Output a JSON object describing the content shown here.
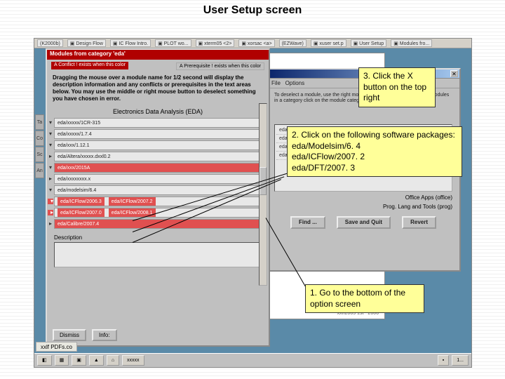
{
  "title": "User Setup screen",
  "winbar": {
    "items": [
      "(K2000b)",
      "▣ Design Flow",
      "▣ IC Flow Intro.",
      "▣ PLOT wo...",
      "▣ xterm05 <2>",
      "▣ xorsac <a>",
      "(EZWave)",
      "▣ xuser set.p",
      "▣ User Setup",
      "▣ Modules fro..."
    ]
  },
  "modules": {
    "title": "Modules from category 'eda'",
    "warn": "A Conflict ! exists when this color",
    "prereq": "A Prerequisite ! exists when this color",
    "instructions": "Dragging the mouse over a module name for 1/2 second will display the description information and any conflicts or prerequisites in the text areas below. You may use the middle or right mouse button to deselect something you have chosen in error.",
    "heading": "Electronics Data Analysis (EDA)",
    "items": [
      {
        "label": "eda/xxxxx/1CR-315",
        "sel": false
      },
      {
        "label": "eda/xxxxx/1.7.4",
        "sel": false
      },
      {
        "label": "eda/xxx/1.12.1",
        "sel": false
      },
      {
        "label": "eda/Altera/xxxxx.dxxl0.2",
        "sel": false
      },
      {
        "label": "eda/xxx/2015A",
        "sel": true
      },
      {
        "label": "eda/xxxxxxxx.x",
        "sel": false
      },
      {
        "label": "eda/modelsim/6.4",
        "sel": false
      },
      {
        "label": "eda/ICFlow/2006.3",
        "sel": true,
        "extra": "eda/ICFlow/2007.2"
      },
      {
        "label": "eda/ICFlow/2007.0",
        "sel": true,
        "extra": "eda/ICFlow/2008.1"
      },
      {
        "label": "eda/Calibre/2007.4",
        "sel": true
      }
    ],
    "desc_label": "Description",
    "dismiss": "Dismiss",
    "info": "Info:"
  },
  "options": {
    "menu_file": "File",
    "menu_options": "Options",
    "hint": "To deselect a module, use the right mouse button on it. To use all of the modules in a category click on the module category icon below.",
    "rows": [
      "eda/xxxxxxxxxx",
      "eda/xxxxx/xxxxxxxxxxx/xxxxxx-SK",
      "eda/xxxxxxx/5.6",
      "eda/xxxxxx/.6"
    ],
    "section1": "Office Apps (office)",
    "section2": "Prog. Lang and Tools (prog)",
    "btn_find": "Find ...",
    "btn_save": "Save and Quit",
    "btn_revert": "Revert"
  },
  "callouts": {
    "c3": "3. Click the X button on the top right",
    "c2": "2. Click on the following software packages:\neda/Modelsim/6. 4\neda/ICFlow/2007. 2\neda/DFT/2007. 3",
    "c1": "1. Go to the bottom of the option screen"
  },
  "taskbar": {
    "items": [
      "◧",
      "▦",
      "▣",
      "▲",
      "⌂",
      "xxxxx",
      "▪",
      "1..."
    ]
  },
  "pdf_tab": "xxlf PDFs.co",
  "doc_footer": "xxn2005 1st ~2006"
}
